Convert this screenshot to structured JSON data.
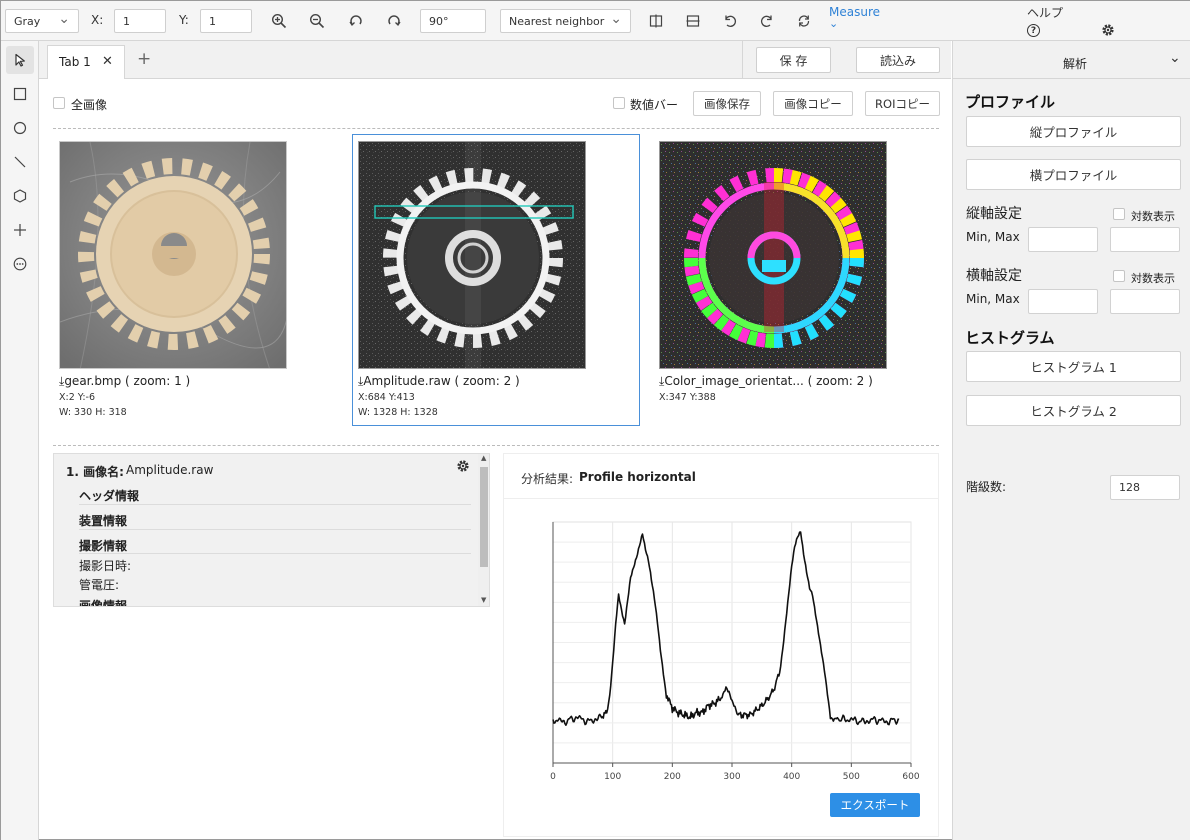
{
  "toolbar": {
    "color_mode": "Gray",
    "x_label": "X:",
    "x_value": "1",
    "y_label": "Y:",
    "y_value": "1",
    "rotation_value": "90°",
    "interpolation": "Nearest neighbor",
    "measure_label": "Measure",
    "help_label": "ヘルプ",
    "help_icon": "?"
  },
  "tabs": {
    "items": [
      {
        "label": "Tab 1",
        "close": "✕"
      }
    ],
    "add": "+"
  },
  "actions": {
    "save": "保 存",
    "load": "読込み"
  },
  "view_options": {
    "full_image": "全画像",
    "value_bar": "数値バー",
    "save_image": "画像保存",
    "copy_image": "画像コピー",
    "copy_roi": "ROIコピー"
  },
  "images": [
    {
      "caption": "gear.bmp ( zoom: 1 )",
      "coords": "X:2  Y:-6",
      "size": "W: 330  H: 318"
    },
    {
      "caption": "Amplitude.raw ( zoom: 2 )",
      "coords": "X:684  Y:413",
      "size": "W: 1328  H: 1328"
    },
    {
      "caption": "Color_image_orientat... ( zoom: 2 )",
      "coords": "X:347  Y:388",
      "size": ""
    }
  ],
  "info": {
    "index_label": "1. 画像名:",
    "image_name": "Amplitude.raw",
    "sections": [
      "ヘッダ情報",
      "装置情報",
      "撮影情報"
    ],
    "fields": [
      "撮影日時:",
      "管電圧:"
    ],
    "cut_section": "画像情報"
  },
  "analysis": {
    "result_label": "分析結果:",
    "result_name": "Profile horizontal",
    "export_label": "エクスポート"
  },
  "chart_data": {
    "type": "line",
    "title": "",
    "xlabel": "",
    "ylabel": "",
    "xlim": [
      0,
      600
    ],
    "x_ticks": [
      0,
      100,
      200,
      300,
      400,
      500,
      600
    ],
    "grid": true,
    "series": [
      {
        "color": "#111111",
        "x": [
          0,
          20,
          40,
          60,
          80,
          90,
          95,
          100,
          105,
          110,
          115,
          120,
          125,
          130,
          135,
          140,
          145,
          150,
          155,
          160,
          165,
          170,
          175,
          180,
          185,
          190,
          200,
          210,
          220,
          230,
          240,
          250,
          260,
          270,
          280,
          285,
          290,
          295,
          300,
          305,
          310,
          320,
          330,
          340,
          350,
          360,
          370,
          380,
          385,
          390,
          395,
          400,
          405,
          410,
          415,
          420,
          425,
          430,
          435,
          440,
          445,
          450,
          455,
          460,
          465,
          470,
          475,
          480,
          500,
          520,
          540,
          560,
          580
        ],
        "y": [
          0.19,
          0.18,
          0.2,
          0.18,
          0.2,
          0.22,
          0.3,
          0.45,
          0.62,
          0.75,
          0.68,
          0.62,
          0.72,
          0.82,
          0.86,
          0.9,
          0.95,
          1.0,
          0.93,
          0.88,
          0.8,
          0.72,
          0.62,
          0.5,
          0.4,
          0.3,
          0.24,
          0.22,
          0.21,
          0.2,
          0.22,
          0.22,
          0.25,
          0.26,
          0.28,
          0.31,
          0.34,
          0.32,
          0.28,
          0.25,
          0.21,
          0.21,
          0.21,
          0.23,
          0.25,
          0.28,
          0.32,
          0.4,
          0.5,
          0.62,
          0.74,
          0.86,
          0.94,
          0.98,
          1.0,
          0.9,
          0.82,
          0.75,
          0.72,
          0.64,
          0.56,
          0.48,
          0.4,
          0.3,
          0.2,
          0.19,
          0.2,
          0.19,
          0.19,
          0.18,
          0.19,
          0.18,
          0.19
        ]
      }
    ]
  },
  "right_panel": {
    "title": "解析",
    "profile_heading": "プロファイル",
    "vertical_profile": "縦プロファイル",
    "horizontal_profile": "横プロファイル",
    "v_axis_label": "縦軸設定",
    "h_axis_label": "横軸設定",
    "log_label": "対数表示",
    "minmax_label": "Min, Max",
    "histogram_heading": "ヒストグラム",
    "histogram1": "ヒストグラム 1",
    "histogram2": "ヒストグラム 2",
    "bins_label": "階級数:",
    "bins_value": "128"
  }
}
